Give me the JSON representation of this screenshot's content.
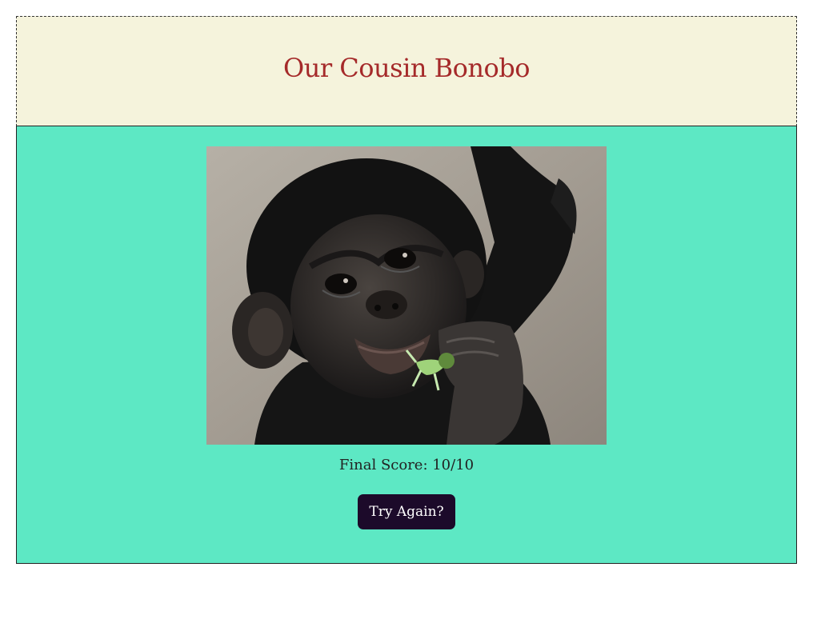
{
  "header": {
    "title": "Our Cousin Bonobo"
  },
  "main": {
    "image_subject": "baby bonobo chewing on a green leaf",
    "score_text": "Final Score: 10/10",
    "retry_label": "Try Again?"
  },
  "colors": {
    "header_bg": "#f5f3dc",
    "title": "#a52a2a",
    "main_bg": "#5de8c4",
    "button_bg": "#1c0a2a",
    "button_text": "#ffffff"
  }
}
